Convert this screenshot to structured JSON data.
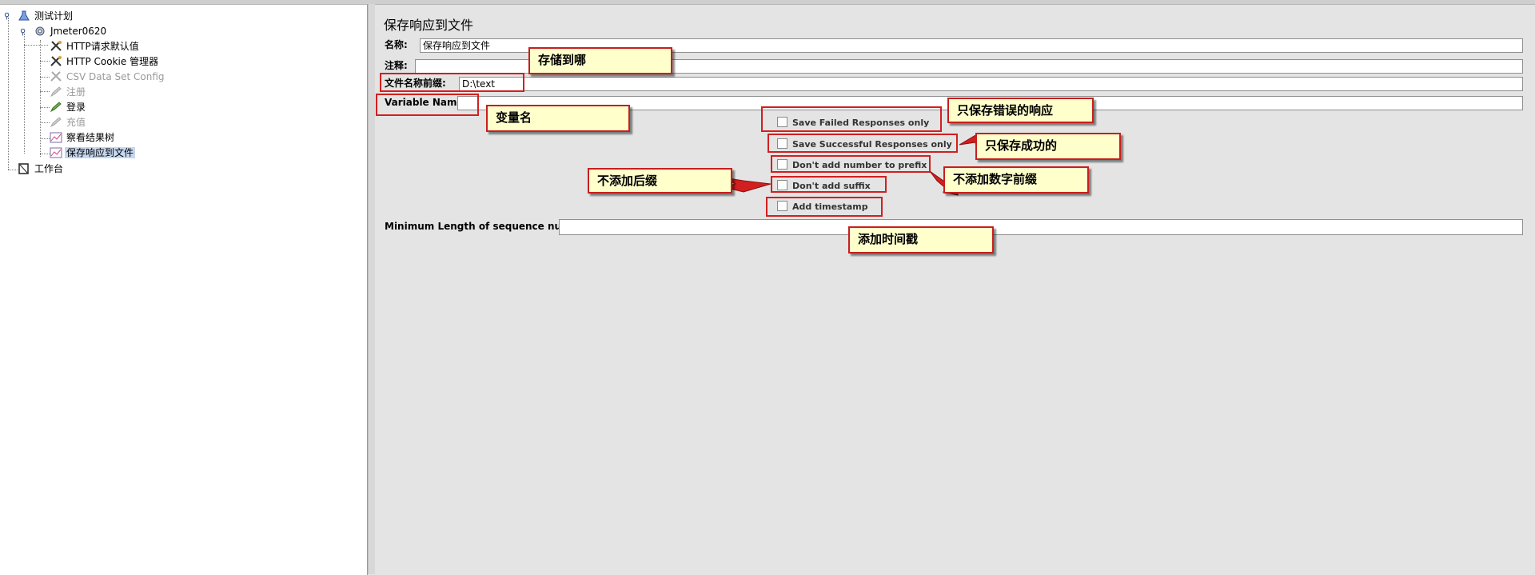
{
  "tree": {
    "items": [
      {
        "label": "测试计划",
        "icon": "test-plan-icon"
      },
      {
        "label": "Jmeter0620",
        "icon": "thread-group-gear-icon"
      },
      {
        "label": "HTTP请求默认值",
        "icon": "config-tools-icon"
      },
      {
        "label": "HTTP Cookie 管理器",
        "icon": "config-tools-icon"
      },
      {
        "label": "CSV Data Set Config",
        "icon": "config-tools-icon",
        "disabled": true
      },
      {
        "label": "注册",
        "icon": "sampler-pencil-icon",
        "disabled": true
      },
      {
        "label": "登录",
        "icon": "sampler-pencil-icon"
      },
      {
        "label": "充值",
        "icon": "sampler-pencil-icon",
        "disabled": true
      },
      {
        "label": "察看结果树",
        "icon": "listener-graph-icon"
      },
      {
        "label": "保存响应到文件",
        "icon": "listener-graph-icon",
        "selected": true
      },
      {
        "label": "工作台",
        "icon": "workbench-icon"
      }
    ]
  },
  "panel": {
    "title": "保存响应到文件",
    "name_label": "名称:",
    "name_value": "保存响应到文件",
    "comment_label": "注释:",
    "comment_value": "",
    "prefix_label": "文件名称前缀:",
    "prefix_value": "D:\\text",
    "varname_label": "Variable Name:",
    "varname_value": "",
    "checkboxes": [
      {
        "label": "Save Failed Responses only",
        "checked": false
      },
      {
        "label": "Save Successful Responses only",
        "checked": false
      },
      {
        "label": "Don't add number to prefix",
        "checked": false
      },
      {
        "label": "Don't add suffix",
        "checked": false
      },
      {
        "label": "Add timestamp",
        "checked": false
      }
    ],
    "minlen_label": "Minimum Length of sequence number",
    "minlen_value": ""
  },
  "annotations": {
    "store_where": "存储到哪",
    "var_name": "变量名",
    "failed_only": "只保存错误的响应",
    "success_only": "只保存成功的",
    "no_suffix": "不添加后缀",
    "no_number_prefix": "不添加数字前缀",
    "add_timestamp": "添加时间戳"
  },
  "colors": {
    "annotation_red": "#d21f1f",
    "annotation_fill": "#ffffcc",
    "selection": "#c6d7ef"
  }
}
